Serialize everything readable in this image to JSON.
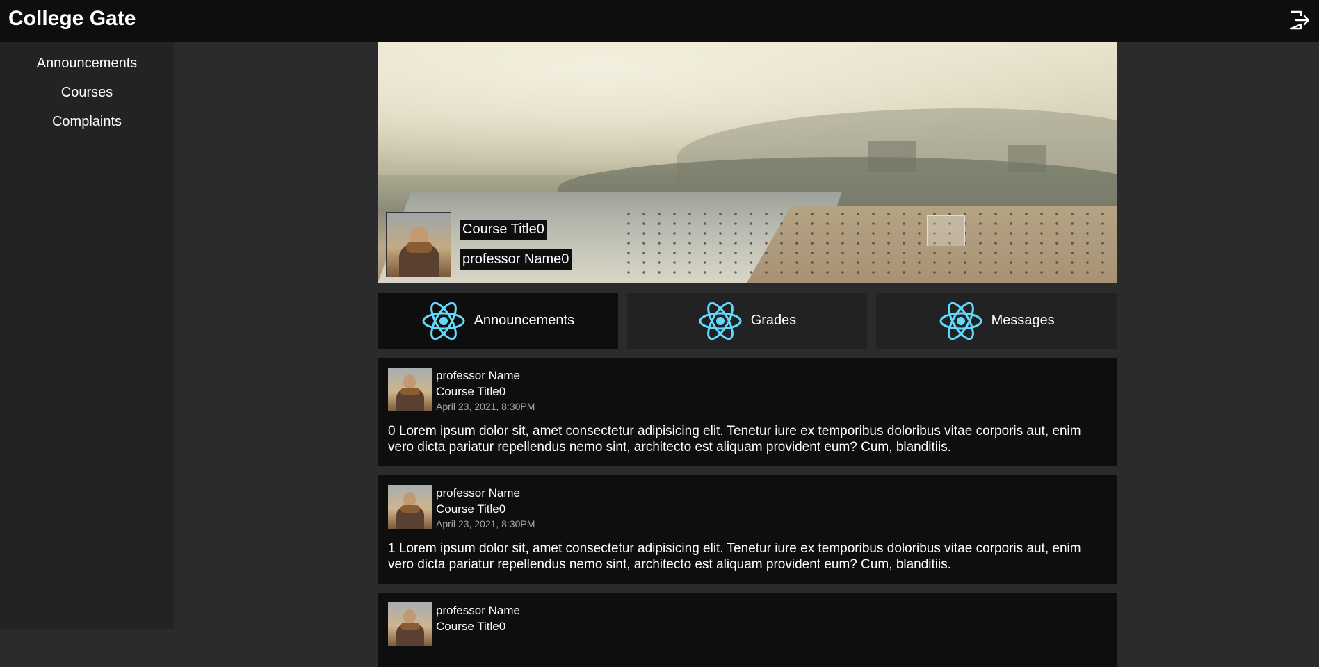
{
  "app": {
    "title": "College Gate",
    "logout_icon": "logout-icon"
  },
  "sidebar": {
    "items": [
      {
        "label": "Announcements"
      },
      {
        "label": "Courses"
      },
      {
        "label": "Complaints"
      }
    ]
  },
  "course": {
    "title": "Course Title0",
    "professor": "professor Name0"
  },
  "tabs": [
    {
      "label": "Announcements",
      "icon": "react-icon",
      "active": true
    },
    {
      "label": "Grades",
      "icon": "react-icon",
      "active": false
    },
    {
      "label": "Messages",
      "icon": "react-icon",
      "active": false
    }
  ],
  "posts": [
    {
      "author": "professor Name",
      "course": "Course Title0",
      "date": "April 23, 2021, 8:30PM",
      "body": "0 Lorem ipsum dolor sit, amet consectetur adipisicing elit. Tenetur iure ex temporibus doloribus vitae corporis aut, enim vero dicta pariatur repellendus nemo sint, architecto est aliquam provident eum? Cum, blanditiis."
    },
    {
      "author": "professor Name",
      "course": "Course Title0",
      "date": "April 23, 2021, 8:30PM",
      "body": "1 Lorem ipsum dolor sit, amet consectetur adipisicing elit. Tenetur iure ex temporibus doloribus vitae corporis aut, enim vero dicta pariatur repellendus nemo sint, architecto est aliquam provident eum? Cum, blanditiis."
    },
    {
      "author": "professor Name",
      "course": "Course Title0",
      "date": "",
      "body": ""
    }
  ],
  "colors": {
    "accent_icon": "#61dafb",
    "panel": "#0e0e0e",
    "background": "#2b2b2e"
  }
}
